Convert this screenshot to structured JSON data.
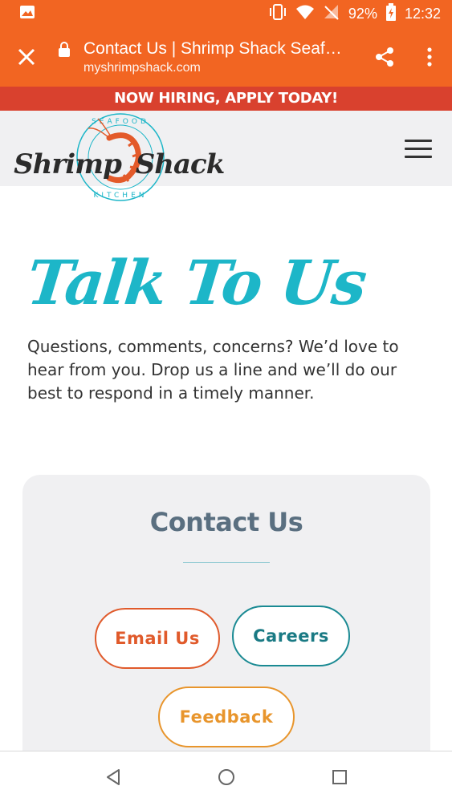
{
  "status_bar": {
    "battery_percent": "92%",
    "time": "12:32",
    "icons": [
      "image-icon",
      "vibrate-icon",
      "wifi-icon",
      "no-signal-icon",
      "battery-charging-icon"
    ]
  },
  "toolbar": {
    "page_title": "Contact Us | Shrimp Shack Seaf…",
    "url": "myshrimpshack.com",
    "color": "#f26522"
  },
  "banner": {
    "text": "NOW HIRING, APPLY TODAY!",
    "color": "#d9412e"
  },
  "header": {
    "logo_text": "Shrimp Shack",
    "logo_ring_top": "SEAFOOD",
    "logo_ring_bottom": "KITCHEN"
  },
  "main": {
    "hero_title": "Talk To Us",
    "intro": "Questions, comments, concerns? We’d love to hear from you. Drop us a line and we’ll do our best to respond in a timely manner."
  },
  "contact_card": {
    "title": "Contact Us",
    "buttons": {
      "email": "Email Us",
      "careers": "Careers",
      "feedback": "Feedback"
    }
  },
  "colors": {
    "accent_teal": "#1db6c8",
    "email_orange": "#e05a2b",
    "careers_teal": "#1a8a93",
    "feedback_amber": "#e8952c"
  }
}
